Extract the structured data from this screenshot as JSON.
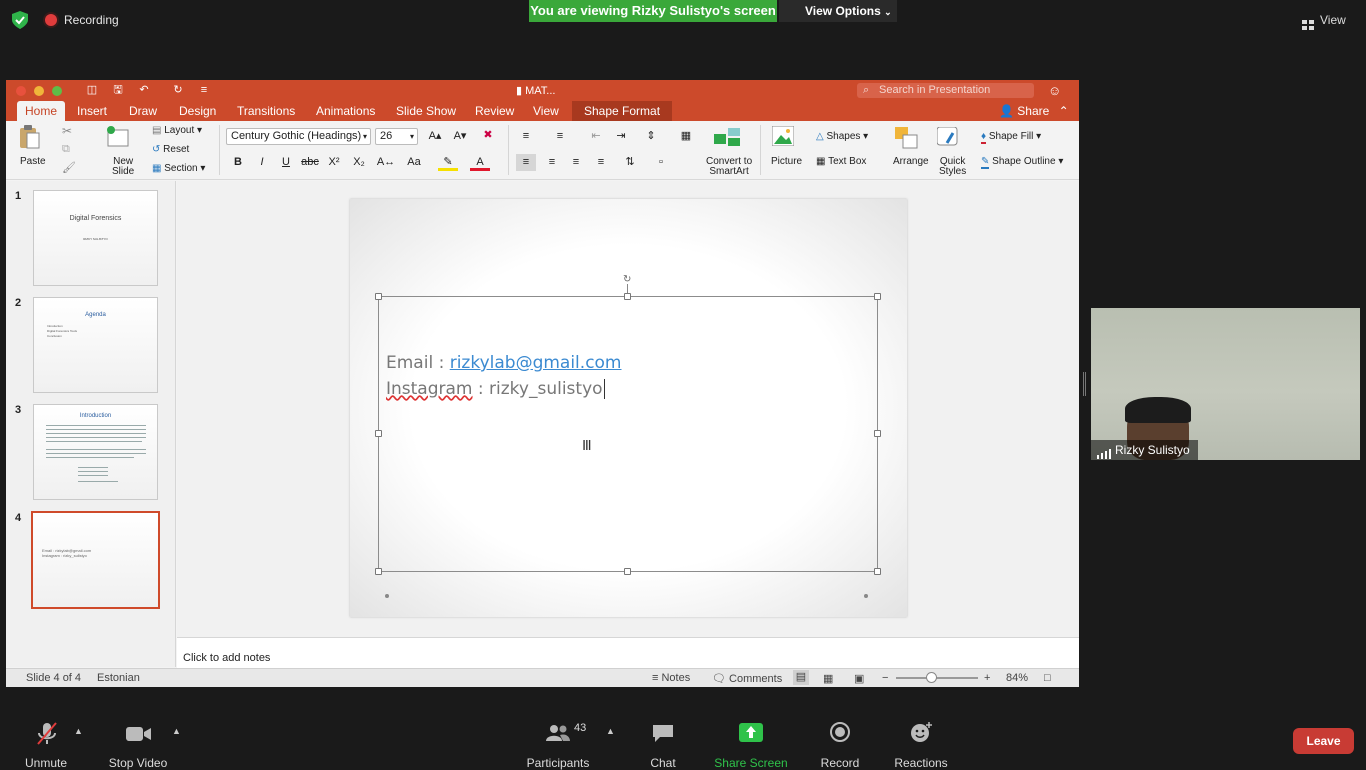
{
  "zoom": {
    "recording_label": "Recording",
    "viewing_banner": "You are viewing Rizky Sulistyo's screen",
    "view_options_label": "View Options",
    "view_button_label": "View",
    "participant_name": "Rizky Sulistyo",
    "toolbar": {
      "unmute": "Unmute",
      "stop_video": "Stop Video",
      "participants": "Participants",
      "participants_count": "43",
      "chat": "Chat",
      "share_screen": "Share Screen",
      "record": "Record",
      "reactions": "Reactions",
      "leave": "Leave"
    },
    "colors": {
      "share_green": "#2fc24a",
      "leave_red": "#c83b34",
      "banner_green": "#3aa83a"
    }
  },
  "ppt": {
    "doc_title": "MAT...",
    "search_placeholder": "Search in Presentation",
    "tabs": [
      "Home",
      "Insert",
      "Draw",
      "Design",
      "Transitions",
      "Animations",
      "Slide Show",
      "Review",
      "View",
      "Shape Format"
    ],
    "share_label": "Share",
    "ribbon": {
      "paste": "Paste",
      "new_slide_line1": "New",
      "new_slide_line2": "Slide",
      "layout": "Layout",
      "reset": "Reset",
      "section": "Section",
      "font_name": "Century Gothic (Headings)",
      "font_size": "26",
      "convert_line1": "Convert to",
      "convert_line2": "SmartArt",
      "picture": "Picture",
      "shapes": "Shapes",
      "text_box": "Text Box",
      "arrange": "Arrange",
      "quick_line1": "Quick",
      "quick_line2": "Styles",
      "shape_fill": "Shape Fill",
      "shape_outline": "Shape Outline"
    },
    "slides": [
      {
        "number": "1",
        "title": "Digital Forensics",
        "subtitle": "RIZKY SULISTYO"
      },
      {
        "number": "2",
        "title": "Agenda",
        "bullets": [
          "Introduction",
          "Digital Forensics Tools",
          "Conclusion"
        ]
      },
      {
        "number": "3",
        "title": "Introduction"
      },
      {
        "number": "4",
        "line1": "Email : rizkylab@gmail.com",
        "line2": "Instagram : rizky_sulistyo"
      }
    ],
    "current_slide": {
      "email_prefix": "Email : ",
      "email_link": "rizkylab@gmail.com",
      "instagram_prefix": "Instagram",
      "instagram_rest": " : rizky_sulistyo"
    },
    "notes_placeholder": "Click to add notes",
    "status": {
      "slide_info": "Slide 4 of 4",
      "language": "Estonian",
      "notes": "Notes",
      "comments": "Comments",
      "zoom": "84%"
    },
    "colors": {
      "accent": "#cc4a2b",
      "link": "#3b8ad1"
    }
  }
}
